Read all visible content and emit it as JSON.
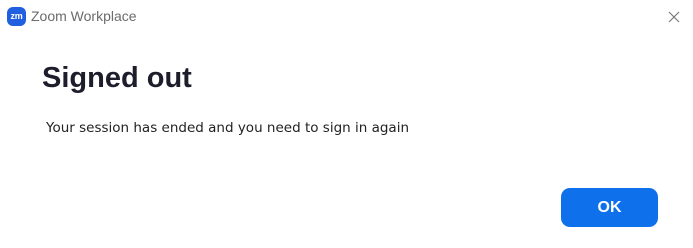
{
  "window": {
    "app_logo_text": "zm",
    "app_title": "Zoom Workplace",
    "close_icon": "close-icon"
  },
  "dialog": {
    "heading": "Signed out",
    "message": "Your session has ended and you need to sign in again",
    "ok_label": "OK"
  },
  "colors": {
    "accent": "#0e71eb",
    "logo": "#1f5fe0",
    "heading": "#1d1d2b"
  }
}
